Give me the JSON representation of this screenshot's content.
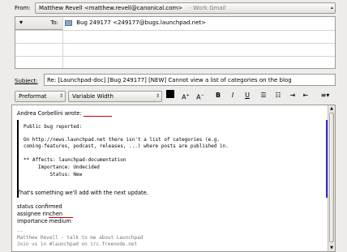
{
  "from": {
    "label": "From:",
    "value": "Matthew Revell <matthew.revell@canonical.com>",
    "account": "- Work Gmail"
  },
  "recipients": {
    "to_label": "To:",
    "to_value": "Bug 249177 <249177@bugs.launchpad.net>"
  },
  "subject": {
    "label": "Subject:",
    "value": "Re: [Launchpad-doc] [Bug 249177] [NEW] Cannot view a list of categories on the blog"
  },
  "toolbar": {
    "paragraph_style": "Preformat",
    "font_name": "Variable Width",
    "font_color": "#000000",
    "bold": "B",
    "italic": "I",
    "underline": "U",
    "grow": "A",
    "shrink": "A"
  },
  "body": {
    "attribution": "Andrea Corbellini wrote:",
    "attribution_name_underlined": "Corbellini",
    "quoted_lines": [
      "Public bug reported:",
      "",
      "On http://news.launchpad.net there isn't a list of categories (e.g.",
      "coming-features, podcast, releases, ...) where posts are published in.",
      "",
      "** Affects: launchpad-documentation",
      "     Importance: Undecided",
      "         Status: New"
    ],
    "reply_line": "That's something we'll add with the next update.",
    "commands": [
      "status confirmed",
      "assignee rinchen",
      "importance medium"
    ],
    "sig_separator": "--",
    "sig_line1": "Matthew Revell - talk to me about Launchpad",
    "sig_line2": "Join us in #launchpad on irc.freenode.net"
  }
}
